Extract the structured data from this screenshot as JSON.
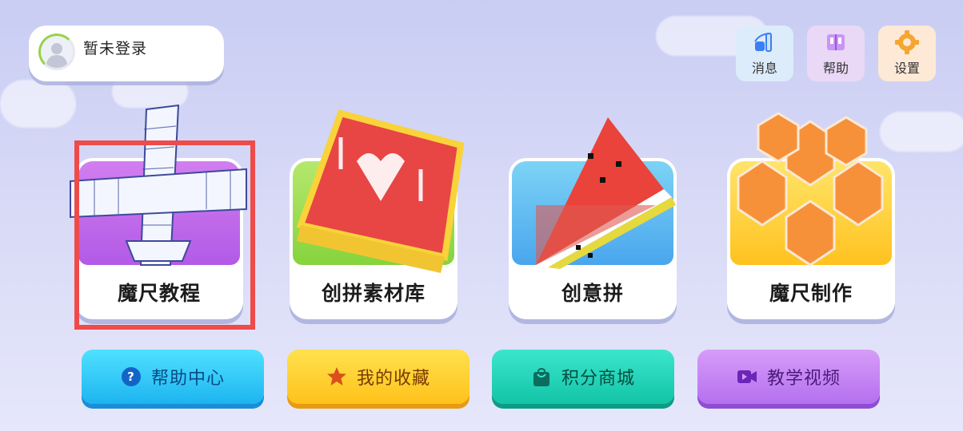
{
  "profile": {
    "status_text": "暂未登录"
  },
  "top_buttons": {
    "message": {
      "label": "消息",
      "icon": "message-icon"
    },
    "help": {
      "label": "帮助",
      "icon": "book-icon"
    },
    "settings": {
      "label": "设置",
      "icon": "gear-icon"
    }
  },
  "cards": [
    {
      "label": "魔尺教程",
      "selected": true
    },
    {
      "label": "创拼素材库",
      "selected": false
    },
    {
      "label": "创意拼",
      "selected": false
    },
    {
      "label": "魔尺制作",
      "selected": false
    }
  ],
  "bottom_buttons": [
    {
      "label": "帮助中心",
      "icon": "question-icon"
    },
    {
      "label": "我的收藏",
      "icon": "star-icon"
    },
    {
      "label": "积分商城",
      "icon": "shopping-bag-icon"
    },
    {
      "label": "教学视频",
      "icon": "video-icon"
    }
  ],
  "colors": {
    "highlight": "#ee4b4b",
    "help_center": "#1db4f0",
    "favorites": "#ffc21a",
    "points_mall": "#13c4a6",
    "videos": "#b470ef"
  }
}
